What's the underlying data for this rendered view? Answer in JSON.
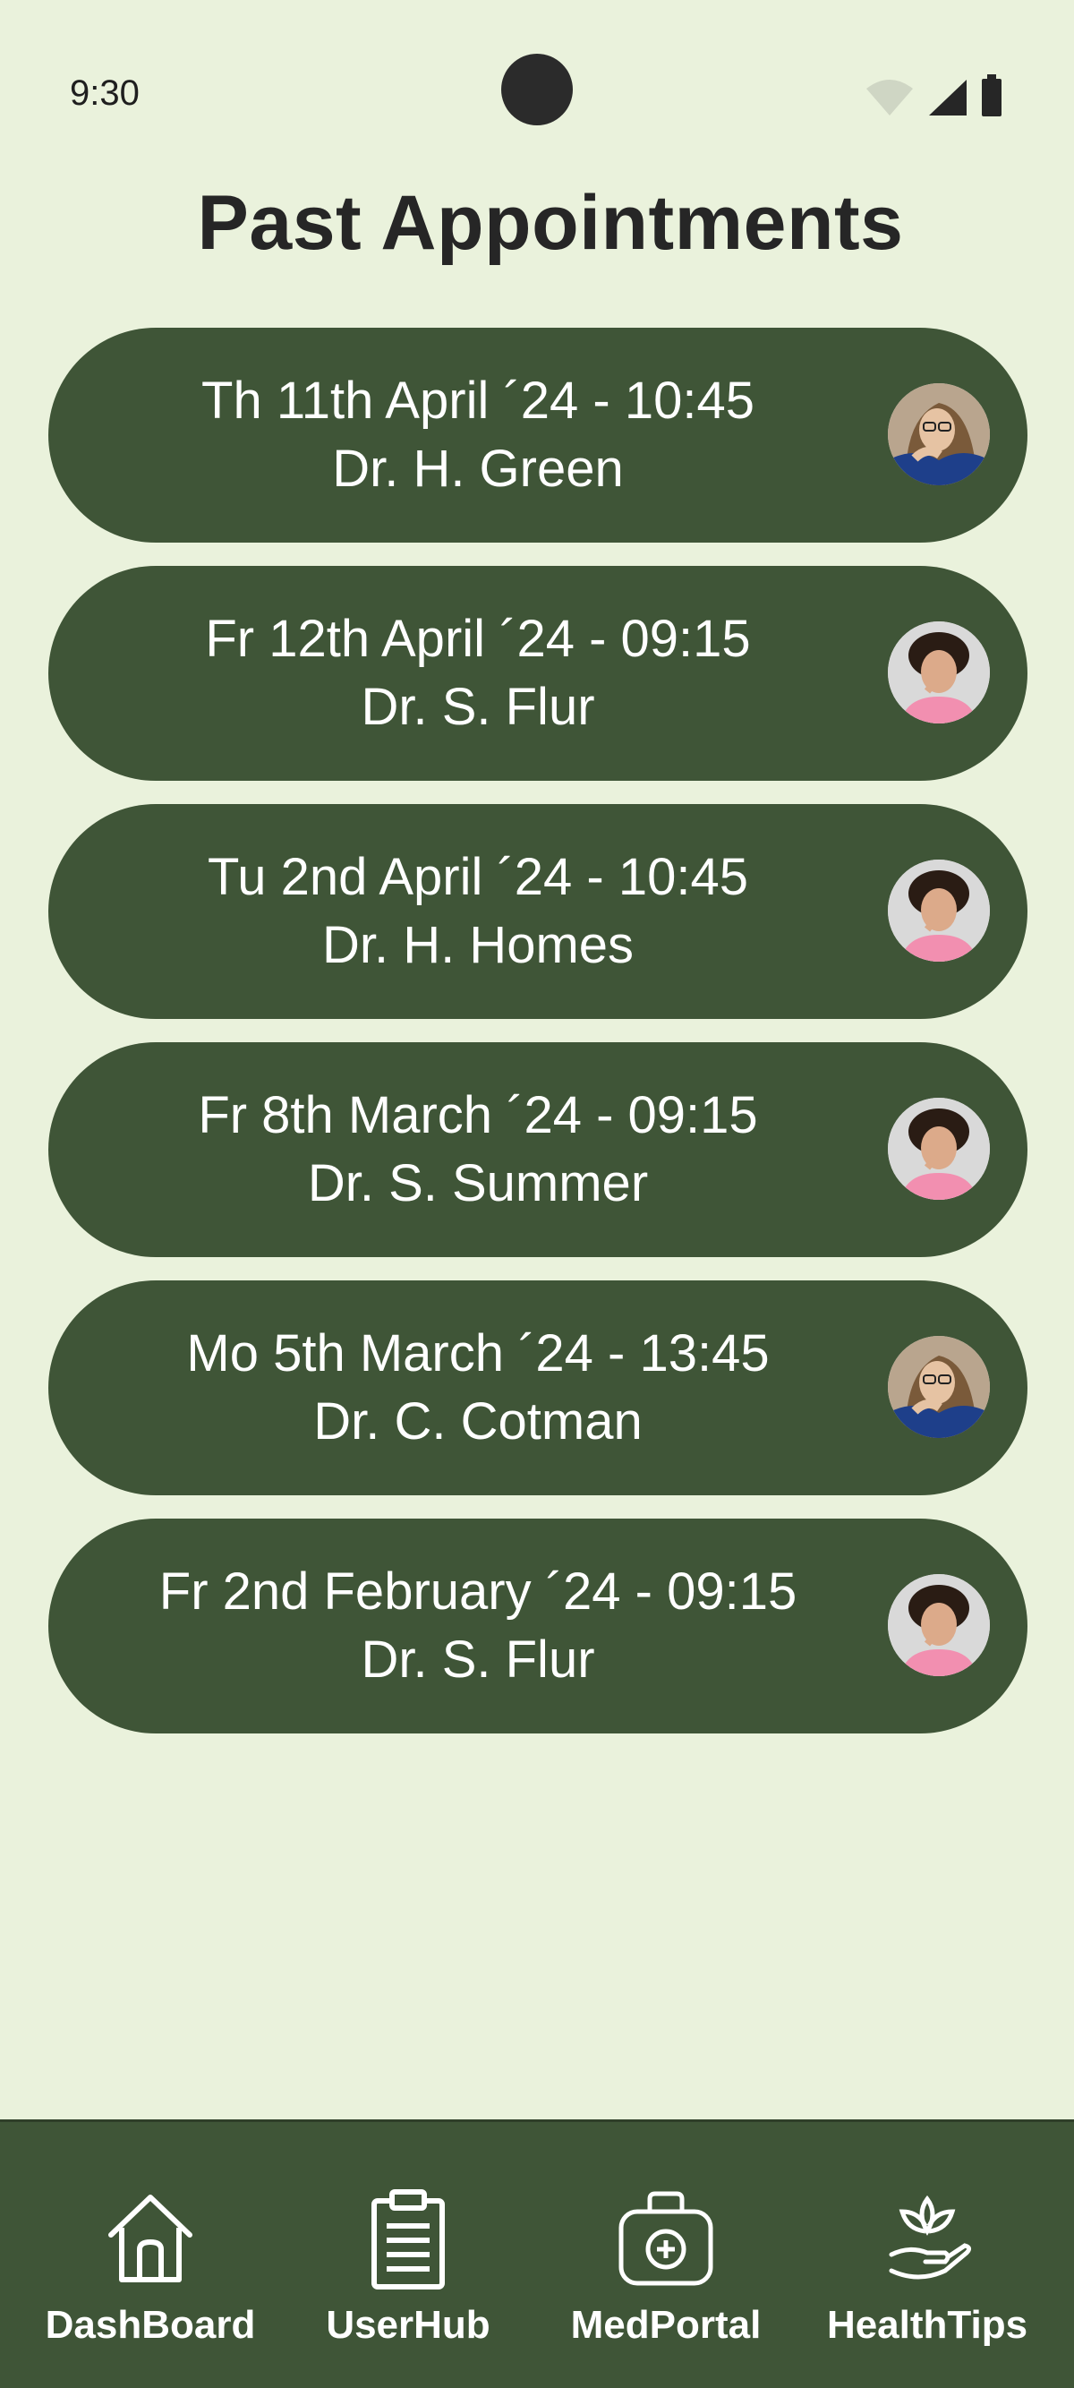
{
  "status_bar": {
    "time": "9:30"
  },
  "title": "Past Appointments",
  "appointments": [
    {
      "date": "Th 11th April ´24 - 10:45",
      "doctor": "Dr. H. Green",
      "avatar_icon": "avatar-glasses-icon"
    },
    {
      "date": "Fr 12th April ´24 - 09:15",
      "doctor": "Dr. S. Flur",
      "avatar_icon": "avatar-curly-icon"
    },
    {
      "date": "Tu 2nd April ´24 - 10:45",
      "doctor": "Dr. H. Homes",
      "avatar_icon": "avatar-curly-icon"
    },
    {
      "date": "Fr 8th March ´24 - 09:15",
      "doctor": "Dr. S. Summer",
      "avatar_icon": "avatar-curly-icon"
    },
    {
      "date": "Mo 5th March ´24 - 13:45",
      "doctor": "Dr. C. Cotman",
      "avatar_icon": "avatar-glasses-icon"
    },
    {
      "date": "Fr 2nd February ´24 - 09:15",
      "doctor": "Dr. S. Flur",
      "avatar_icon": "avatar-curly-icon"
    }
  ],
  "bottom_nav": {
    "items": [
      {
        "label": "DashBoard",
        "icon": "home-icon"
      },
      {
        "label": "UserHub",
        "icon": "clipboard-icon"
      },
      {
        "label": "MedPortal",
        "icon": "medkit-icon"
      },
      {
        "label": "HealthTips",
        "icon": "lotus-hand-icon"
      }
    ]
  },
  "colors": {
    "background": "#eaf2dc",
    "card": "#3f5537",
    "card_text": "#ffffff",
    "title_text": "#262626"
  }
}
